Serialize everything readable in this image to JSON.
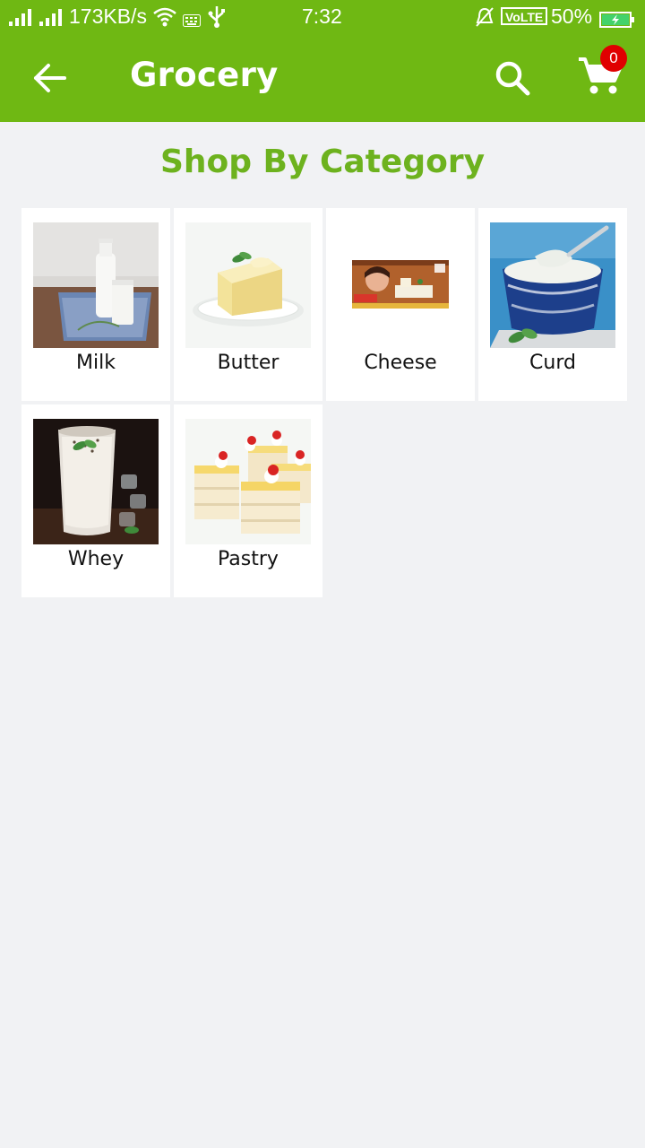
{
  "status_bar": {
    "network_speed": "173KB/s",
    "time": "7:32",
    "volte": "VoLTE",
    "battery": "50%"
  },
  "app_bar": {
    "title": "Grocery",
    "cart_count": "0",
    "icons": [
      "back-arrow-icon",
      "search-icon",
      "cart-icon"
    ]
  },
  "heading": "Shop By Category",
  "categories": [
    {
      "label": "Milk"
    },
    {
      "label": "Butter"
    },
    {
      "label": "Cheese"
    },
    {
      "label": "Curd"
    },
    {
      "label": "Whey"
    },
    {
      "label": "Pastry"
    }
  ],
  "colors": {
    "primary": "#6fb813",
    "heading": "#6db21e",
    "badge": "#e00000",
    "background": "#f1f2f4"
  }
}
